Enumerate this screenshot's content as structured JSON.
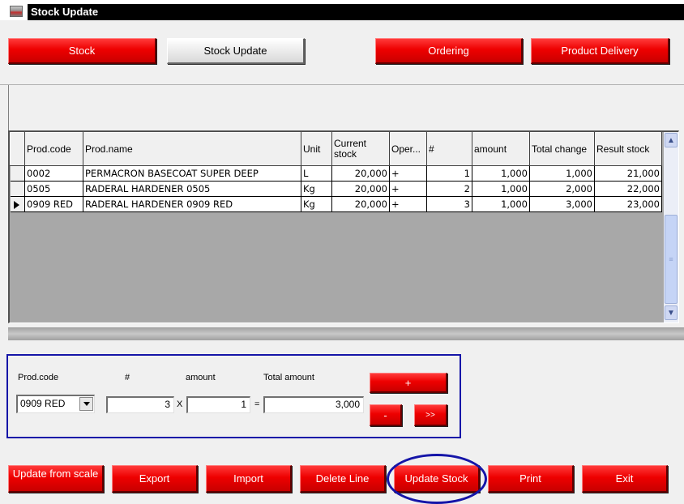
{
  "window": {
    "title": "Stock Update"
  },
  "top_tabs": {
    "stock": "Stock",
    "stock_update": "Stock Update",
    "ordering": "Ordering",
    "product_delivery": "Product Delivery"
  },
  "grid": {
    "headers": [
      "Prod.code",
      "Prod.name",
      "Unit",
      "Current stock",
      "Oper...",
      "#",
      "amount",
      "Total change",
      "Result stock"
    ],
    "rows": [
      {
        "code": "0002",
        "name": "PERMACRON BASECOAT SUPER DEEP",
        "unit": "L",
        "current": "20,000",
        "oper": "+",
        "num": "1",
        "amount": "1,000",
        "total": "1,000",
        "result": "21,000",
        "selected": false
      },
      {
        "code": "0505",
        "name": "RADERAL HARDENER 0505",
        "unit": "Kg",
        "current": "20,000",
        "oper": "+",
        "num": "2",
        "amount": "1,000",
        "total": "2,000",
        "result": "22,000",
        "selected": false
      },
      {
        "code": "0909 RED",
        "name": "RADERAL HARDENER 0909 RED",
        "unit": "Kg",
        "current": "20,000",
        "oper": "+",
        "num": "3",
        "amount": "1,000",
        "total": "3,000",
        "result": "23,000",
        "selected": true
      }
    ]
  },
  "entry": {
    "prod_code_label": "Prod.code",
    "num_label": "#",
    "amount_label": "amount",
    "total_label": "Total amount",
    "prod_code_value": "0909 RED",
    "num_value": "3",
    "times": "X",
    "amount_value": "1",
    "equals": "=",
    "total_value": "3,000",
    "plus_btn": "+",
    "minus_btn": "-",
    "next_btn": ">>"
  },
  "bottom": {
    "update_from_scale": "Update from scale",
    "export": "Export",
    "import": "Import",
    "delete_line": "Delete Line",
    "update_stock": "Update Stock",
    "print": "Print",
    "exit": "Exit"
  },
  "colors": {
    "button_red": "#ee0000",
    "highlight_blue": "#1515a8",
    "grid_bg": "#a8a8a8"
  }
}
